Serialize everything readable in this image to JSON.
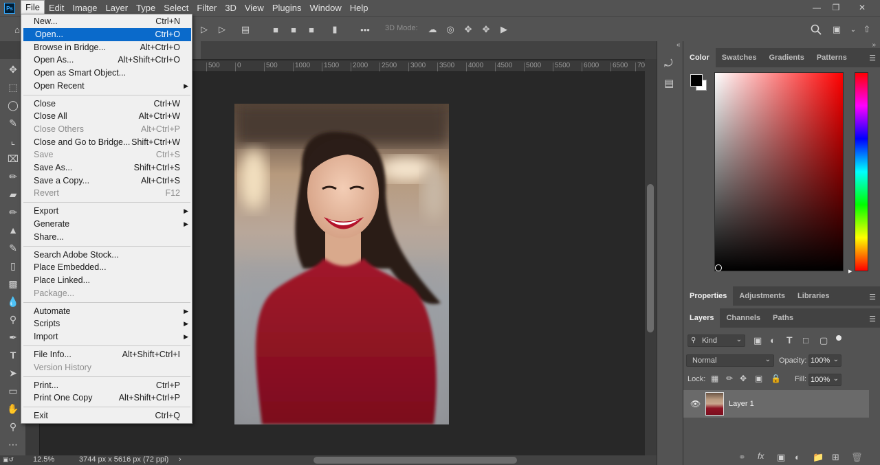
{
  "menubar": {
    "logo": "Ps",
    "items": [
      "File",
      "Edit",
      "Image",
      "Layer",
      "Type",
      "Select",
      "Filter",
      "3D",
      "View",
      "Plugins",
      "Window",
      "Help"
    ],
    "active": "File"
  },
  "options_bar": {
    "mode_label": "3D Mode:",
    "more": "•••"
  },
  "file_menu": {
    "items": [
      {
        "label": "New...",
        "shortcut": "Ctrl+N",
        "disabled": false
      },
      {
        "label": "Open...",
        "shortcut": "Ctrl+O",
        "disabled": false,
        "highlighted": true
      },
      {
        "label": "Browse in Bridge...",
        "shortcut": "Alt+Ctrl+O",
        "disabled": false
      },
      {
        "label": "Open As...",
        "shortcut": "Alt+Shift+Ctrl+O",
        "disabled": false
      },
      {
        "label": "Open as Smart Object...",
        "shortcut": "",
        "disabled": false
      },
      {
        "label": "Open Recent",
        "shortcut": "",
        "disabled": false,
        "submenu": true
      },
      {
        "label": "Close",
        "shortcut": "Ctrl+W",
        "disabled": false
      },
      {
        "label": "Close All",
        "shortcut": "Alt+Ctrl+W",
        "disabled": false
      },
      {
        "label": "Close Others",
        "shortcut": "Alt+Ctrl+P",
        "disabled": true
      },
      {
        "label": "Close and Go to Bridge...",
        "shortcut": "Shift+Ctrl+W",
        "disabled": false
      },
      {
        "label": "Save",
        "shortcut": "Ctrl+S",
        "disabled": true
      },
      {
        "label": "Save As...",
        "shortcut": "Shift+Ctrl+S",
        "disabled": false
      },
      {
        "label": "Save a Copy...",
        "shortcut": "Alt+Ctrl+S",
        "disabled": false
      },
      {
        "label": "Revert",
        "shortcut": "F12",
        "disabled": true
      },
      {
        "label": "Export",
        "shortcut": "",
        "disabled": false,
        "submenu": true
      },
      {
        "label": "Generate",
        "shortcut": "",
        "disabled": false,
        "submenu": true
      },
      {
        "label": "Share...",
        "shortcut": "",
        "disabled": false
      },
      {
        "label": "Search Adobe Stock...",
        "shortcut": "",
        "disabled": false
      },
      {
        "label": "Place Embedded...",
        "shortcut": "",
        "disabled": false
      },
      {
        "label": "Place Linked...",
        "shortcut": "",
        "disabled": false
      },
      {
        "label": "Package...",
        "shortcut": "",
        "disabled": true
      },
      {
        "label": "Automate",
        "shortcut": "",
        "disabled": false,
        "submenu": true
      },
      {
        "label": "Scripts",
        "shortcut": "",
        "disabled": false,
        "submenu": true
      },
      {
        "label": "Import",
        "shortcut": "",
        "disabled": false,
        "submenu": true
      },
      {
        "label": "File Info...",
        "shortcut": "Alt+Shift+Ctrl+I",
        "disabled": false
      },
      {
        "label": "Version History",
        "shortcut": "",
        "disabled": true
      },
      {
        "label": "Print...",
        "shortcut": "Ctrl+P",
        "disabled": false
      },
      {
        "label": "Print One Copy",
        "shortcut": "Alt+Shift+Ctrl+P",
        "disabled": false
      },
      {
        "label": "Exit",
        "shortcut": "Ctrl+Q",
        "disabled": false
      }
    ]
  },
  "ruler": {
    "ticks": [
      "500",
      "0",
      "500",
      "1000",
      "1500",
      "2000",
      "2500",
      "3000",
      "3500",
      "4000",
      "4500",
      "5000",
      "5500",
      "6000",
      "6500",
      "70"
    ]
  },
  "status": {
    "zoom": "12.5%",
    "doc_info": "3744 px x 5616 px (72 ppi)"
  },
  "panels": {
    "color_tabs": [
      "Color",
      "Swatches",
      "Gradients",
      "Patterns"
    ],
    "properties_tabs": [
      "Properties",
      "Adjustments",
      "Libraries"
    ],
    "layers_tabs": [
      "Layers",
      "Channels",
      "Paths"
    ],
    "filter_kind": "Kind",
    "blend_mode": "Normal",
    "opacity_label": "Opacity:",
    "opacity_value": "100%",
    "lock_label": "Lock:",
    "fill_label": "Fill:",
    "fill_value": "100%",
    "layer_name": "Layer 1"
  },
  "colors": {
    "highlight": "#0a6acb",
    "foreground": "#000000",
    "background": "#ffffff"
  }
}
